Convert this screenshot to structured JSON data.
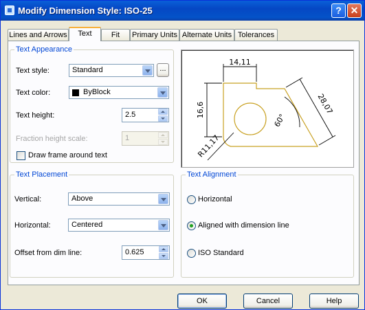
{
  "window": {
    "title": "Modify Dimension Style: ISO-25",
    "help_glyph": "?",
    "close_glyph": "✕"
  },
  "tabs": [
    {
      "label": "Lines and Arrows"
    },
    {
      "label": "Text"
    },
    {
      "label": "Fit"
    },
    {
      "label": "Primary Units"
    },
    {
      "label": "Alternate Units"
    },
    {
      "label": "Tolerances"
    }
  ],
  "active_tab": "Text",
  "text_appearance": {
    "title": "Text Appearance",
    "text_style_label": "Text style:",
    "text_style_value": "Standard",
    "browse_label": "...",
    "text_color_label": "Text color:",
    "text_color_value": "ByBlock",
    "text_color_swatch": "#000000",
    "text_height_label": "Text height:",
    "text_height_value": "2.5",
    "fraction_label": "Fraction height scale:",
    "fraction_value": "1",
    "frame_label": "Draw frame around text",
    "frame_checked": false
  },
  "preview": {
    "dim_top": "14,11",
    "dim_left": "16,6",
    "dim_right": "28,07",
    "dim_angle": "60°",
    "dim_radius": "R11,17",
    "line_color": "#c8a020"
  },
  "text_placement": {
    "title": "Text Placement",
    "vertical_label": "Vertical:",
    "vertical_value": "Above",
    "horizontal_label": "Horizontal:",
    "horizontal_value": "Centered",
    "offset_label": "Offset from dim line:",
    "offset_value": "0.625"
  },
  "text_alignment": {
    "title": "Text Alignment",
    "options": [
      "Horizontal",
      "Aligned with dimension line",
      "ISO Standard"
    ],
    "selected": "Aligned with dimension line"
  },
  "buttons": {
    "ok": "OK",
    "cancel": "Cancel",
    "help": "Help"
  }
}
